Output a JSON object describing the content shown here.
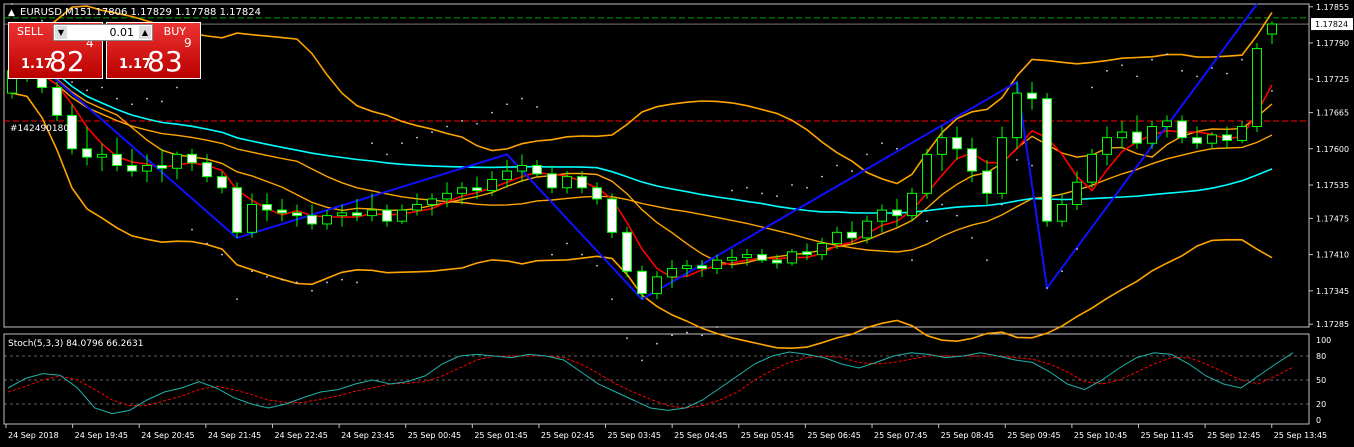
{
  "header": {
    "symbol": "EURUSD,M15",
    "ohlc": "1.17806 1.17829 1.17788 1.17824"
  },
  "trade_panel": {
    "sell_label": "SELL",
    "buy_label": "BUY",
    "lot": "0.01",
    "sell_small": "1.17",
    "sell_big": "82",
    "sell_sup": "4",
    "buy_small": "1.17",
    "buy_big": "83",
    "buy_sup": "9"
  },
  "order_label": "#142490180",
  "colors": {
    "background": "#000000",
    "bull_candle": "#ffffff",
    "bear_candle": "#ffffff",
    "candle_border": "#00ff00",
    "bollinger": "#ffa500",
    "envelope": "#ffa040",
    "ma_fast": "#ff0000",
    "ma_slow": "#00ffff",
    "zigzag": "#1010ff",
    "sar": "#ffffff",
    "stoch_main": "#20b2aa",
    "stoch_signal": "#ff0000",
    "grid_dashed": "#c0c0c0",
    "order_line": "#ff0000",
    "price_line": "#00a000"
  },
  "chart_data": [
    {
      "type": "candlestick",
      "title": "EURUSD,M15",
      "yaxis_ticks": [
        "1.17855",
        "1.17790",
        "1.17725",
        "1.17665",
        "1.17600",
        "1.17535",
        "1.17475",
        "1.17410",
        "1.17345",
        "1.17285"
      ],
      "ylim": [
        1.1728,
        1.1786
      ],
      "current_price": "1.17824",
      "order_level": 1.1765,
      "price_level": 1.17835,
      "xaxis_ticks": [
        "24 Sep 2018",
        "24 Sep 19:45",
        "24 Sep 20:45",
        "24 Sep 21:45",
        "24 Sep 22:45",
        "24 Sep 23:45",
        "25 Sep 00:45",
        "25 Sep 01:45",
        "25 Sep 02:45",
        "25 Sep 03:45",
        "25 Sep 04:45",
        "25 Sep 05:45",
        "25 Sep 06:45",
        "25 Sep 07:45",
        "25 Sep 08:45",
        "25 Sep 09:45",
        "25 Sep 10:45",
        "25 Sep 11:45",
        "25 Sep 12:45",
        "25 Sep 13:45"
      ],
      "candles": [
        [
          1.177,
          1.1776,
          1.1769,
          1.1774
        ],
        [
          1.1774,
          1.1778,
          1.1772,
          1.1775
        ],
        [
          1.1775,
          1.1777,
          1.177,
          1.1771
        ],
        [
          1.1771,
          1.1772,
          1.1765,
          1.1766
        ],
        [
          1.1766,
          1.1768,
          1.1759,
          1.176
        ],
        [
          1.176,
          1.1764,
          1.1757,
          1.17585
        ],
        [
          1.17585,
          1.1761,
          1.1756,
          1.1759
        ],
        [
          1.1759,
          1.1762,
          1.1756,
          1.1757
        ],
        [
          1.1757,
          1.176,
          1.1755,
          1.1756
        ],
        [
          1.1756,
          1.1759,
          1.1754,
          1.1757
        ],
        [
          1.1757,
          1.176,
          1.1754,
          1.17565
        ],
        [
          1.17565,
          1.17595,
          1.17545,
          1.1759
        ],
        [
          1.1759,
          1.176,
          1.1756,
          1.17575
        ],
        [
          1.17575,
          1.1759,
          1.1754,
          1.1755
        ],
        [
          1.1755,
          1.1756,
          1.1752,
          1.1753
        ],
        [
          1.1753,
          1.1754,
          1.1744,
          1.1745
        ],
        [
          1.1745,
          1.1752,
          1.1744,
          1.175
        ],
        [
          1.175,
          1.1752,
          1.1747,
          1.1749
        ],
        [
          1.1749,
          1.1751,
          1.1747,
          1.17485
        ],
        [
          1.17485,
          1.175,
          1.1746,
          1.1748
        ],
        [
          1.1748,
          1.175,
          1.17455,
          1.17465
        ],
        [
          1.17465,
          1.1749,
          1.17455,
          1.1748
        ],
        [
          1.1748,
          1.175,
          1.1746,
          1.17485
        ],
        [
          1.17485,
          1.1751,
          1.1747,
          1.1748
        ],
        [
          1.1748,
          1.1752,
          1.1747,
          1.1749
        ],
        [
          1.1749,
          1.175,
          1.1746,
          1.1747
        ],
        [
          1.1747,
          1.175,
          1.17465,
          1.1749
        ],
        [
          1.1749,
          1.1752,
          1.1748,
          1.175
        ],
        [
          1.175,
          1.1752,
          1.1748,
          1.1751
        ],
        [
          1.1751,
          1.1754,
          1.17495,
          1.1752
        ],
        [
          1.1752,
          1.1754,
          1.175,
          1.1753
        ],
        [
          1.1753,
          1.1755,
          1.1751,
          1.17525
        ],
        [
          1.17525,
          1.1756,
          1.17515,
          1.17545
        ],
        [
          1.17545,
          1.1758,
          1.1753,
          1.1756
        ],
        [
          1.1756,
          1.1759,
          1.1754,
          1.1757
        ],
        [
          1.1757,
          1.1758,
          1.1755,
          1.17555
        ],
        [
          1.17555,
          1.1757,
          1.1752,
          1.1753
        ],
        [
          1.1753,
          1.1756,
          1.1752,
          1.1755
        ],
        [
          1.1755,
          1.1756,
          1.1752,
          1.1753
        ],
        [
          1.1753,
          1.1754,
          1.175,
          1.1751
        ],
        [
          1.1751,
          1.1752,
          1.1744,
          1.1745
        ],
        [
          1.1745,
          1.1746,
          1.1737,
          1.1738
        ],
        [
          1.1738,
          1.1739,
          1.1733,
          1.1734
        ],
        [
          1.1734,
          1.1738,
          1.1733,
          1.1737
        ],
        [
          1.1737,
          1.174,
          1.1735,
          1.17385
        ],
        [
          1.17385,
          1.174,
          1.1737,
          1.1739
        ],
        [
          1.1739,
          1.174,
          1.1737,
          1.17385
        ],
        [
          1.17385,
          1.1741,
          1.17375,
          1.174
        ],
        [
          1.174,
          1.1742,
          1.17385,
          1.17405
        ],
        [
          1.17405,
          1.1742,
          1.1739,
          1.1741
        ],
        [
          1.1741,
          1.1742,
          1.17395,
          1.174
        ],
        [
          1.174,
          1.1741,
          1.17385,
          1.17395
        ],
        [
          1.17395,
          1.1742,
          1.1739,
          1.17415
        ],
        [
          1.17415,
          1.1743,
          1.174,
          1.1741
        ],
        [
          1.1741,
          1.1744,
          1.174,
          1.1743
        ],
        [
          1.1743,
          1.1746,
          1.1742,
          1.1745
        ],
        [
          1.1745,
          1.1747,
          1.1743,
          1.1744
        ],
        [
          1.1744,
          1.1748,
          1.1743,
          1.1747
        ],
        [
          1.1747,
          1.175,
          1.1745,
          1.1749
        ],
        [
          1.1749,
          1.1751,
          1.1746,
          1.1748
        ],
        [
          1.1748,
          1.1753,
          1.1747,
          1.1752
        ],
        [
          1.1752,
          1.176,
          1.1751,
          1.1759
        ],
        [
          1.1759,
          1.1764,
          1.1756,
          1.1762
        ],
        [
          1.1762,
          1.1764,
          1.1758,
          1.176
        ],
        [
          1.176,
          1.1762,
          1.1754,
          1.1756
        ],
        [
          1.1756,
          1.1758,
          1.175,
          1.1752
        ],
        [
          1.1752,
          1.1764,
          1.1751,
          1.1762
        ],
        [
          1.1762,
          1.1772,
          1.176,
          1.177
        ],
        [
          1.177,
          1.1772,
          1.1767,
          1.1769
        ],
        [
          1.1769,
          1.177,
          1.1746,
          1.1747
        ],
        [
          1.1747,
          1.1752,
          1.1746,
          1.175
        ],
        [
          1.175,
          1.1756,
          1.1749,
          1.1754
        ],
        [
          1.1754,
          1.176,
          1.1753,
          1.1759
        ],
        [
          1.1759,
          1.1764,
          1.1757,
          1.1762
        ],
        [
          1.1762,
          1.1765,
          1.176,
          1.1763
        ],
        [
          1.1763,
          1.1766,
          1.176,
          1.1761
        ],
        [
          1.1761,
          1.1765,
          1.176,
          1.1764
        ],
        [
          1.1764,
          1.1766,
          1.1762,
          1.1765
        ],
        [
          1.1765,
          1.1766,
          1.1761,
          1.1762
        ],
        [
          1.1762,
          1.1764,
          1.176,
          1.1761
        ],
        [
          1.1761,
          1.1763,
          1.176,
          1.17625
        ],
        [
          1.17625,
          1.1764,
          1.176,
          1.17615
        ],
        [
          1.17615,
          1.1765,
          1.1761,
          1.1764
        ],
        [
          1.1764,
          1.1779,
          1.1763,
          1.1778
        ],
        [
          1.17806,
          1.17829,
          1.17788,
          1.17824
        ]
      ]
    },
    {
      "type": "line",
      "title": "Stoch(5,3,3) 84.0796 66.2631",
      "ylim": [
        0,
        100
      ],
      "yaxis_ticks": [
        "100",
        "80",
        "50",
        "20",
        "0"
      ],
      "series": [
        {
          "values": [
            40,
            52,
            58,
            56,
            40,
            15,
            8,
            12,
            25,
            35,
            40,
            48,
            40,
            28,
            20,
            15,
            20,
            28,
            35,
            38,
            45,
            50,
            45,
            48,
            55,
            70,
            80,
            82,
            80,
            78,
            82,
            80,
            75,
            60,
            45,
            35,
            25,
            15,
            12,
            15,
            25,
            40,
            55,
            70,
            80,
            85,
            82,
            78,
            70,
            65,
            72,
            80,
            84,
            82,
            78,
            80,
            84,
            80,
            75,
            72,
            60,
            45,
            38,
            50,
            65,
            78,
            84,
            82,
            70,
            55,
            45,
            40,
            55,
            70,
            84
          ]
        },
        {
          "values": [
            35,
            42,
            50,
            55,
            50,
            38,
            25,
            18,
            18,
            24,
            30,
            38,
            42,
            38,
            32,
            25,
            22,
            22,
            26,
            30,
            36,
            40,
            45,
            46,
            48,
            55,
            65,
            75,
            80,
            80,
            80,
            80,
            78,
            70,
            58,
            45,
            35,
            26,
            18,
            15,
            18,
            25,
            35,
            50,
            62,
            72,
            78,
            80,
            78,
            72,
            70,
            72,
            76,
            80,
            80,
            80,
            80,
            80,
            78,
            76,
            70,
            60,
            48,
            45,
            50,
            60,
            70,
            78,
            78,
            70,
            60,
            50,
            45,
            55,
            66
          ]
        }
      ]
    }
  ]
}
